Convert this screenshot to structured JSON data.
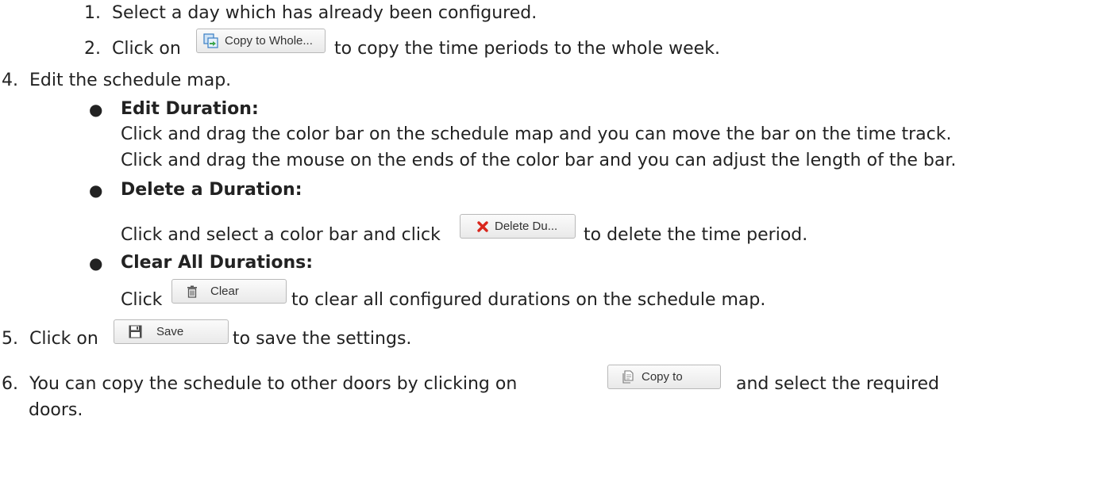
{
  "steps": {
    "s1": {
      "num": "1.",
      "text": "Select a day which has already been configured."
    },
    "s2": {
      "num": "2.",
      "before": "Click on",
      "after": "to copy the time periods to the whole week."
    },
    "s4": {
      "num": "4.",
      "text": "Edit the schedule map."
    },
    "edit": {
      "title": "Edit Duration:",
      "line1": "Click and drag the color bar on the schedule map and you can move the bar on the time track.",
      "line2": "Click and drag the mouse on the ends of the color bar and you can adjust the length of the bar."
    },
    "delete": {
      "title": "Delete a Duration:",
      "before": "Click and select a color bar and click",
      "after": "to delete the time period."
    },
    "clear": {
      "title": "Clear All Durations:",
      "before": "Click",
      "after": "to clear all configured durations on the schedule map."
    },
    "s5": {
      "num": "5.",
      "before": "Click on",
      "after": "to save the settings."
    },
    "s6": {
      "num": "6.",
      "before": "You can copy the schedule to other doors by clicking on",
      "after": "and select the required",
      "line2": "doors."
    }
  },
  "buttons": {
    "copy_whole": {
      "label": "Copy to Whole...",
      "icon": "copy-to-whole-icon"
    },
    "delete_du": {
      "label": "Delete Du...",
      "icon": "red-x-icon",
      "icon_color": "#d9261c"
    },
    "clear": {
      "label": "Clear",
      "icon": "trash-icon"
    },
    "save": {
      "label": "Save",
      "icon": "floppy-disk-icon"
    },
    "copy_to": {
      "label": "Copy to",
      "icon": "copy-document-icon"
    }
  }
}
